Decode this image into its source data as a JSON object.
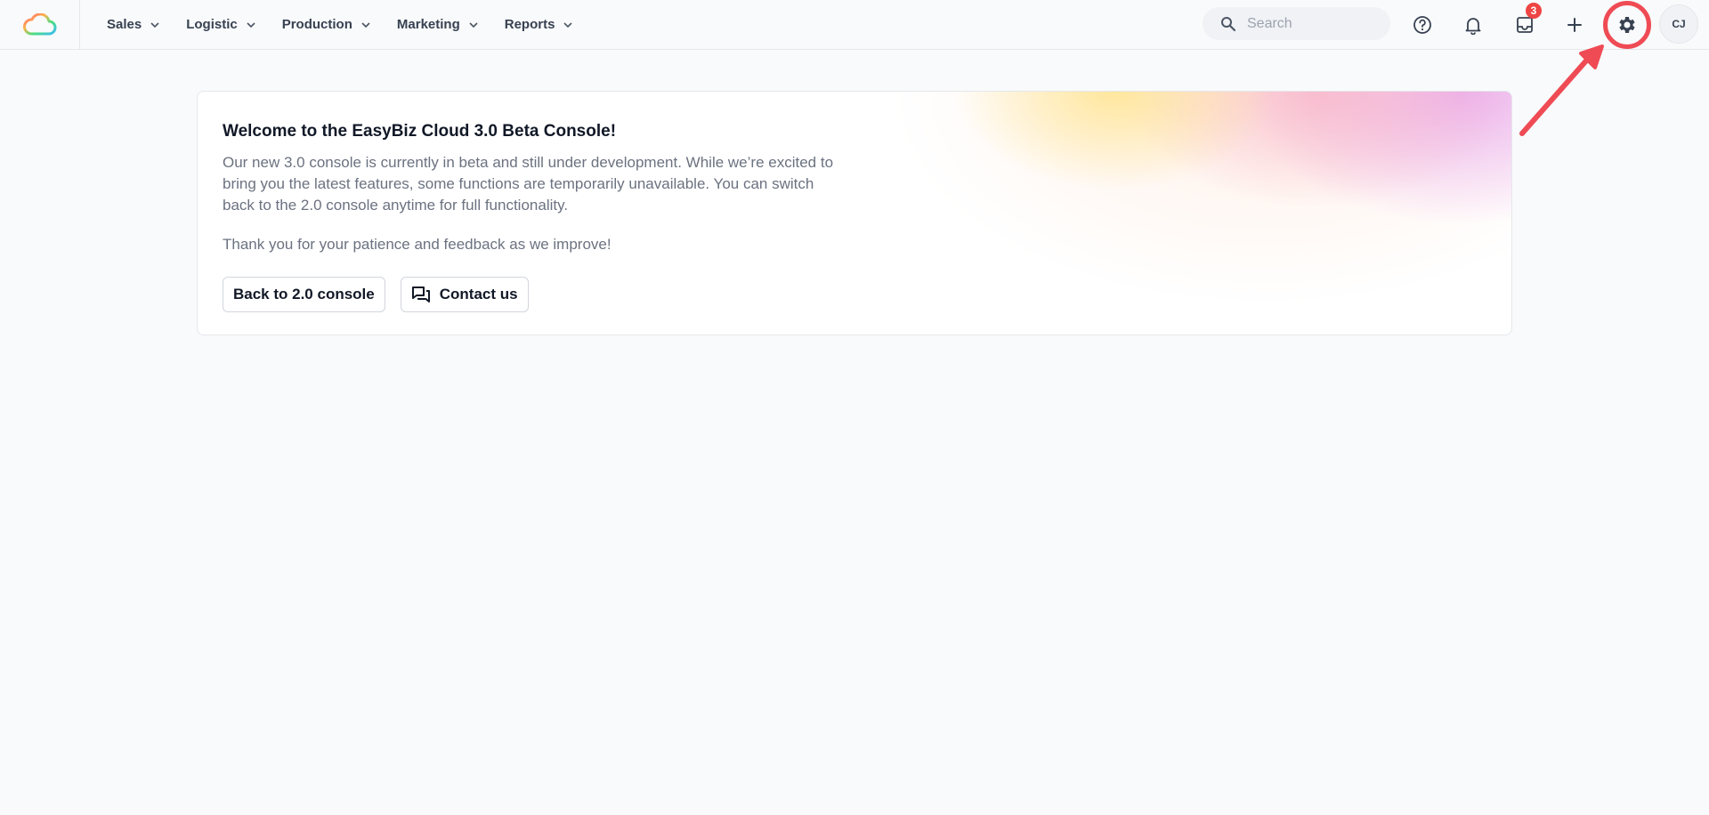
{
  "nav": {
    "items": [
      {
        "label": "Sales"
      },
      {
        "label": "Logistic"
      },
      {
        "label": "Production"
      },
      {
        "label": "Marketing"
      },
      {
        "label": "Reports"
      }
    ]
  },
  "search": {
    "placeholder": "Search",
    "icon": "search-icon"
  },
  "header": {
    "icons": [
      "help-circle-icon",
      "bell-icon",
      "inbox-icon",
      "plus-icon",
      "gear-icon"
    ],
    "inbox_badge": "3",
    "avatar_initials": "CJ"
  },
  "welcome": {
    "title": "Welcome to the EasyBiz Cloud 3.0 Beta Console!",
    "body": "Our new 3.0 console is currently in beta and still under development. While we’re excited to bring you the latest features, some functions are temporarily unavailable. You can switch back to the 2.0 console anytime for full functionality.",
    "thanks": "Thank you for your patience and feedback as we improve!",
    "back_button": "Back to 2.0 console",
    "contact_button": "Contact us"
  },
  "colors": {
    "accent_red": "#ef4b55",
    "badge_red": "#ef4444",
    "background": "#f9fafb"
  }
}
